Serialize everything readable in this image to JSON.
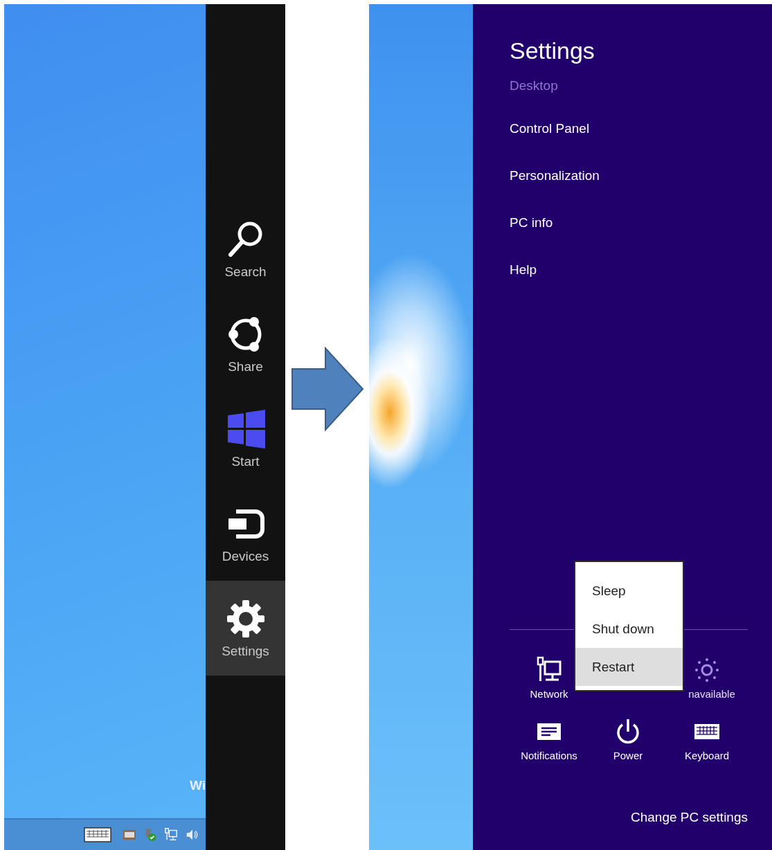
{
  "left_screen": {
    "desktop_text": "Wi",
    "tray_icons": [
      {
        "kind": "keyboard"
      },
      {
        "kind": "vm"
      },
      {
        "kind": "usb"
      },
      {
        "kind": "network"
      },
      {
        "kind": "speaker"
      }
    ],
    "charms": [
      {
        "label": "Search",
        "kind": "search",
        "selected": false
      },
      {
        "label": "Share",
        "kind": "share",
        "selected": false
      },
      {
        "label": "Start",
        "kind": "start",
        "selected": false
      },
      {
        "label": "Devices",
        "kind": "devices",
        "selected": false
      },
      {
        "label": "Settings",
        "kind": "settings",
        "selected": true
      }
    ]
  },
  "right_screen": {
    "settings_pane": {
      "title": "Settings",
      "subtitle": "Desktop",
      "links": [
        "Control Panel",
        "Personalization",
        "PC info",
        "Help"
      ],
      "tiles": [
        {
          "label": "Network",
          "kind": "network",
          "disabled": false
        },
        {
          "label": "navailable",
          "kind": "brightness",
          "disabled": true
        },
        {
          "label": "Notifications",
          "kind": "notifications",
          "disabled": false
        },
        {
          "label": "Power",
          "kind": "power",
          "disabled": false
        },
        {
          "label": "Keyboard",
          "kind": "keyboard",
          "disabled": false
        }
      ],
      "power_menu": [
        {
          "label": "Sleep",
          "selected": false
        },
        {
          "label": "Shut down",
          "selected": false
        },
        {
          "label": "Restart",
          "selected": true
        }
      ],
      "footer_link": "Change PC settings"
    }
  }
}
